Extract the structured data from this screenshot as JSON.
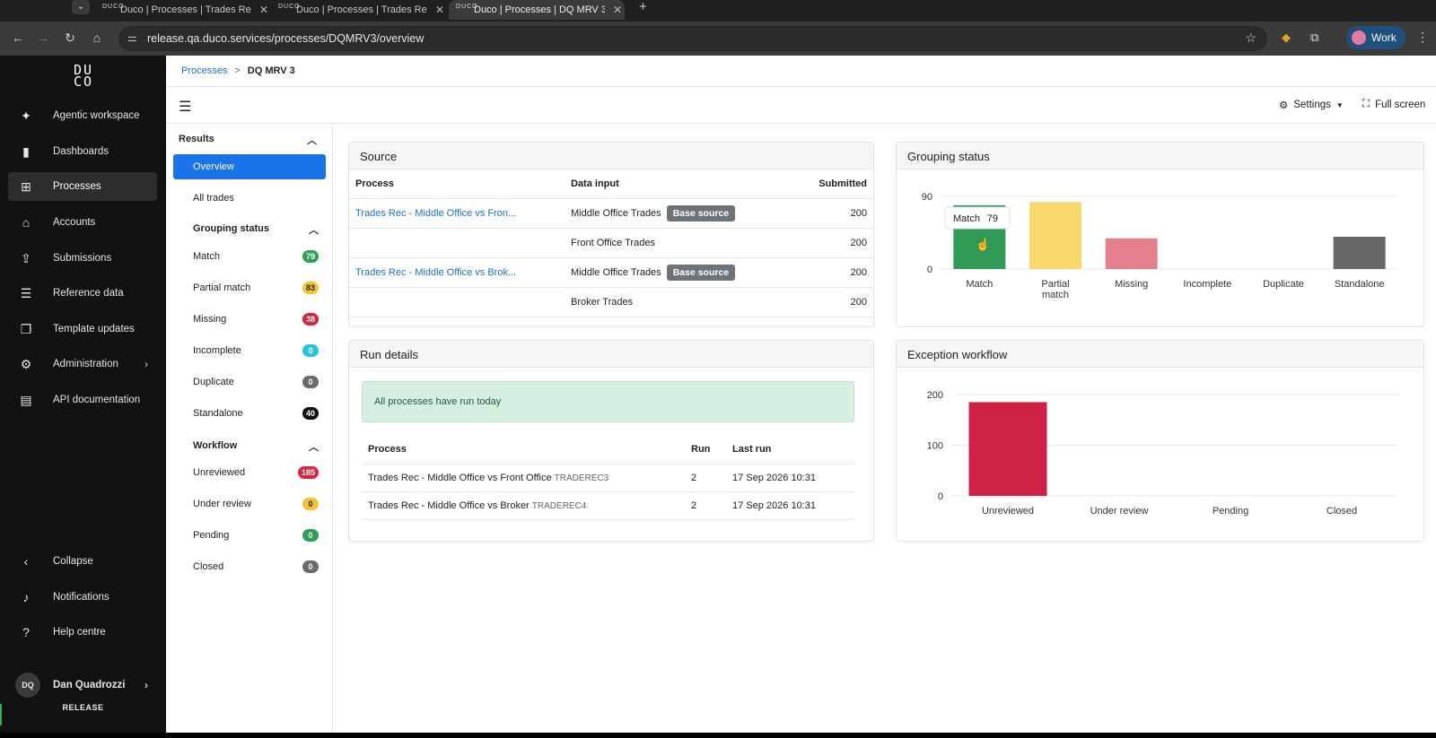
{
  "browser": {
    "tabs": [
      {
        "title": "Duco | Processes | Trades Rec",
        "active": false
      },
      {
        "title": "Duco | Processes | Trades Rec",
        "active": false
      },
      {
        "title": "Duco | Processes | DQ MRV 3",
        "active": true
      }
    ],
    "favicon_text": "DUCO",
    "url": "release.qa.duco.services/processes/DQMRV3/overview",
    "profile_label": "Work"
  },
  "sidebar": {
    "logo": "DUCO",
    "items": [
      {
        "label": "Agentic workspace",
        "icon": "sparkle-icon",
        "glyph": "✦"
      },
      {
        "label": "Dashboards",
        "icon": "bar-chart-icon",
        "glyph": "▮"
      },
      {
        "label": "Processes",
        "icon": "processes-icon",
        "glyph": "⊞"
      },
      {
        "label": "Accounts",
        "icon": "bank-icon",
        "glyph": "⌂"
      },
      {
        "label": "Submissions",
        "icon": "upload-icon",
        "glyph": "⇪"
      },
      {
        "label": "Reference data",
        "icon": "list-icon",
        "glyph": "☰"
      },
      {
        "label": "Template updates",
        "icon": "document-icon",
        "glyph": "❐"
      },
      {
        "label": "Administration",
        "icon": "gear-icon",
        "glyph": "⚙"
      },
      {
        "label": "API documentation",
        "icon": "doc-icon",
        "glyph": "▤"
      }
    ],
    "bottom": [
      {
        "label": "Collapse",
        "glyph": "‹"
      },
      {
        "label": "Notifications",
        "glyph": "♪"
      },
      {
        "label": "Help centre",
        "glyph": "?"
      }
    ],
    "user": {
      "initials": "DQ",
      "name": "Dan Quadrozzi"
    },
    "env_label": "RELEASE"
  },
  "breadcrumb": {
    "parent": "Processes",
    "separator": ">",
    "current": "DQ MRV 3"
  },
  "header": {
    "settings_label": "Settings",
    "fullscreen_label": "Full screen"
  },
  "subnav": {
    "results_label": "Results",
    "overview_label": "Overview",
    "all_trades_label": "All trades",
    "grouping_label": "Grouping status",
    "grouping_items": [
      {
        "label": "Match",
        "count": "79",
        "color": "#2f9e57"
      },
      {
        "label": "Partial match",
        "count": "83",
        "color": "#f4c430"
      },
      {
        "label": "Missing",
        "count": "38",
        "color": "#d7263d"
      },
      {
        "label": "Incomplete",
        "count": "0",
        "color": "#29c4dc"
      },
      {
        "label": "Duplicate",
        "count": "0",
        "color": "#6b6b6b"
      },
      {
        "label": "Standalone",
        "count": "40",
        "color": "#111111"
      }
    ],
    "workflow_label": "Workflow",
    "workflow_items": [
      {
        "label": "Unreviewed",
        "count": "185",
        "color": "#d7263d"
      },
      {
        "label": "Under review",
        "count": "0",
        "color": "#f4c430"
      },
      {
        "label": "Pending",
        "count": "0",
        "color": "#2f9e57"
      },
      {
        "label": "Closed",
        "count": "0",
        "color": "#6b6b6b"
      }
    ]
  },
  "source": {
    "title": "Source",
    "columns": [
      "Process",
      "Data input",
      "Submitted"
    ],
    "rows": [
      {
        "process": "Trades Rec - Middle Office vs Fron...",
        "input": "Middle Office Trades",
        "badge": "Base source",
        "submitted": "200"
      },
      {
        "process": "",
        "input": "Front Office Trades",
        "badge": "",
        "submitted": "200"
      },
      {
        "process": "Trades Rec - Middle Office vs Brok...",
        "input": "Middle Office Trades",
        "badge": "Base source",
        "submitted": "200"
      },
      {
        "process": "",
        "input": "Broker Trades",
        "badge": "",
        "submitted": "200"
      }
    ]
  },
  "run_details": {
    "title": "Run details",
    "alert": "All processes have run today",
    "columns": [
      "Process",
      "Run",
      "Last run"
    ],
    "rows": [
      {
        "process": "Trades Rec - Middle Office vs Front Office",
        "code": "TRADEREC3",
        "run": "2",
        "last_run": "17 Sep 2026 10:31"
      },
      {
        "process": "Trades Rec - Middle Office vs Broker",
        "code": "TRADEREC4",
        "run": "2",
        "last_run": "17 Sep 2026 10:31"
      }
    ]
  },
  "chart_data": [
    {
      "type": "bar",
      "title": "Grouping status",
      "categories": [
        "Match",
        "Partial match",
        "Missing",
        "Incomplete",
        "Duplicate",
        "Standalone"
      ],
      "values": [
        79,
        83,
        38,
        0,
        0,
        40
      ],
      "colors": [
        "#2e9a55",
        "#f8d86a",
        "#e47f8e",
        "#29c4dc",
        "#888888",
        "#676767"
      ],
      "ylim": [
        0,
        90
      ],
      "yticks": [
        "0",
        "90"
      ],
      "tooltip": {
        "label": "Match",
        "value": "79"
      },
      "grid": true
    },
    {
      "type": "bar",
      "title": "Exception workflow",
      "categories": [
        "Unreviewed",
        "Under review",
        "Pending",
        "Closed"
      ],
      "values": [
        185,
        0,
        0,
        0
      ],
      "colors": [
        "#cd2245",
        "#f4c430",
        "#2f9e57",
        "#6b6b6b"
      ],
      "ylim": [
        0,
        200
      ],
      "yticks": [
        "0",
        "100",
        "200"
      ],
      "grid": true
    }
  ]
}
